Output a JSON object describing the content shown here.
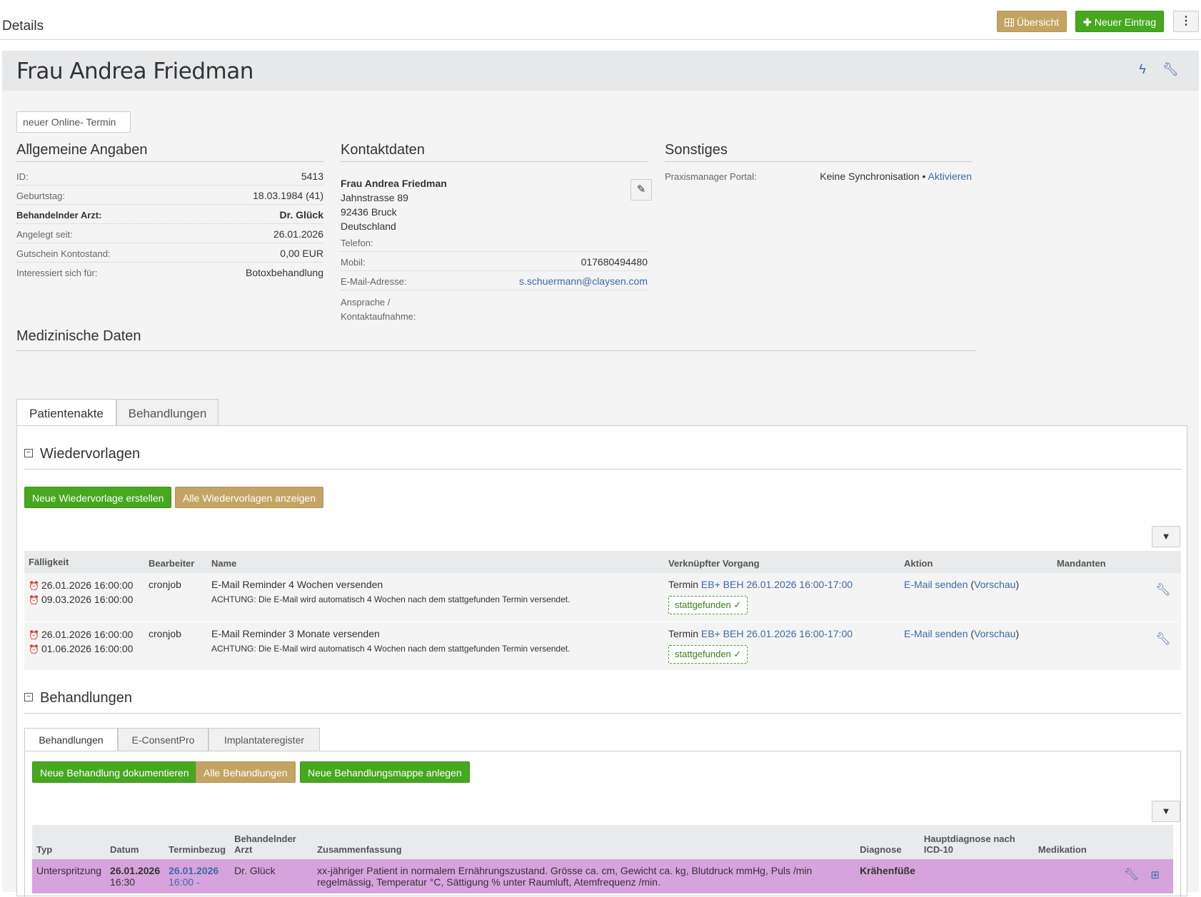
{
  "topbar": {
    "title": "Details",
    "overview_label": "Übersicht",
    "new_entry_label": "Neuer Eintrag",
    "more_label": "⋮"
  },
  "patient": {
    "name": "Frau Andrea Friedman"
  },
  "online_select": {
    "value": "neuer Online- Termin"
  },
  "general": {
    "title": "Allgemeine Angaben",
    "rows": [
      {
        "label": "ID:",
        "value": "5413"
      },
      {
        "label": "Geburtstag:",
        "value": "18.03.1984 (41)"
      },
      {
        "label": "Behandelnder Arzt:",
        "value": "Dr. Glück"
      },
      {
        "label": "Angelegt seit:",
        "value": "26.01.2026"
      },
      {
        "label": "Gutschein Kontostand:",
        "value": "0,00 EUR"
      },
      {
        "label": "Interessiert sich für:",
        "value": "Botoxbehandlung"
      }
    ]
  },
  "contact": {
    "title": "Kontaktdaten",
    "name": "Frau Andrea Friedman",
    "street": "Jahnstrasse 89",
    "city": "92436 Bruck",
    "country": "Deutschland",
    "phone_label": "Telefon:",
    "phone_value": "",
    "mobile_label": "Mobil:",
    "mobile_value": "017680494480",
    "email_label": "E-Mail-Adresse:",
    "email_value": "s.schuermann@claysen.com",
    "contact_label_1": "Ansprache /",
    "contact_label_2": "Kontaktaufnahme:"
  },
  "misc": {
    "title": "Sonstiges",
    "portal_label": "Praxismanager Portal:",
    "portal_value": "Keine Synchronisation",
    "portal_sep": "•",
    "portal_link": "Aktivieren"
  },
  "medical": {
    "title": "Medizinische Daten",
    "tabs": [
      "Patientenakte",
      "Behandlungen"
    ]
  },
  "reminders": {
    "title": "Wiedervorlagen",
    "new_label": "Neue Wiedervorlage erstellen",
    "all_label": "Alle Wiedervorlagen anzeigen",
    "columns": [
      "Fälligkeit",
      "Bearbeiter",
      "Name",
      "Verknüpfter Vorgang",
      "Aktion",
      "Mandanten"
    ],
    "rows": [
      {
        "due1": "26.01.2026 16:00:00",
        "due2": "09.03.2026 16:00:00",
        "editor": "cronjob",
        "name": "E-Mail Reminder 4 Wochen versenden",
        "note": "ACHTUNG: Die E-Mail wird automatisch 4 Wochen nach dem stattgefunden Termin versendet.",
        "vorgang_prefix": "Termin",
        "vorgang_link": "EB+ BEH 26.01.2026 16:00-17:00",
        "status": "stattgefunden ✓",
        "action_link": "E-Mail senden",
        "action_preview": "Vorschau"
      },
      {
        "due1": "26.01.2026 16:00:00",
        "due2": "01.06.2026 16:00:00",
        "editor": "cronjob",
        "name": "E-Mail Reminder 3 Monate versenden",
        "note": "ACHTUNG: Die E-Mail wird automatisch 4 Wochen nach dem stattgefunden Termin versendet.",
        "vorgang_prefix": "Termin",
        "vorgang_link": "EB+ BEH 26.01.2026 16:00-17:00",
        "status": "stattgefunden ✓",
        "action_link": "E-Mail senden",
        "action_preview": "Vorschau"
      }
    ]
  },
  "treatments": {
    "title": "Behandlungen",
    "tabs": [
      "Behandlungen",
      "E-ConsentPro",
      "Implantateregister"
    ],
    "new_label": "Neue Behandlung dokumentieren",
    "all_label": "Alle Behandlungen",
    "folder_label": "Neue Behandlungsmappe anlegen",
    "columns": [
      "Typ",
      "Datum",
      "Terminbezug",
      "Behandelnder Arzt",
      "Zusammenfassung",
      "Diagnose",
      "Hauptdiagnose nach ICD-10",
      "Medikation"
    ],
    "row": {
      "type": "Unterspritzung",
      "date": "26.01.2026",
      "time": "16:30",
      "ref_date": "26.01.2026",
      "ref_time": "16:00 -",
      "doctor": "Dr. Glück",
      "summary": "xx-jähriger Patient in normalem Ernährungszustand. Grösse ca. cm, Gewicht ca. kg, Blutdruck mmHg, Puls /min regelmässig, Temperatur °C, Sättigung % unter Raumluft, Atemfrequenz /min.",
      "diagnosis": "Krähenfüße",
      "row_color": "#d7a3dc"
    }
  }
}
